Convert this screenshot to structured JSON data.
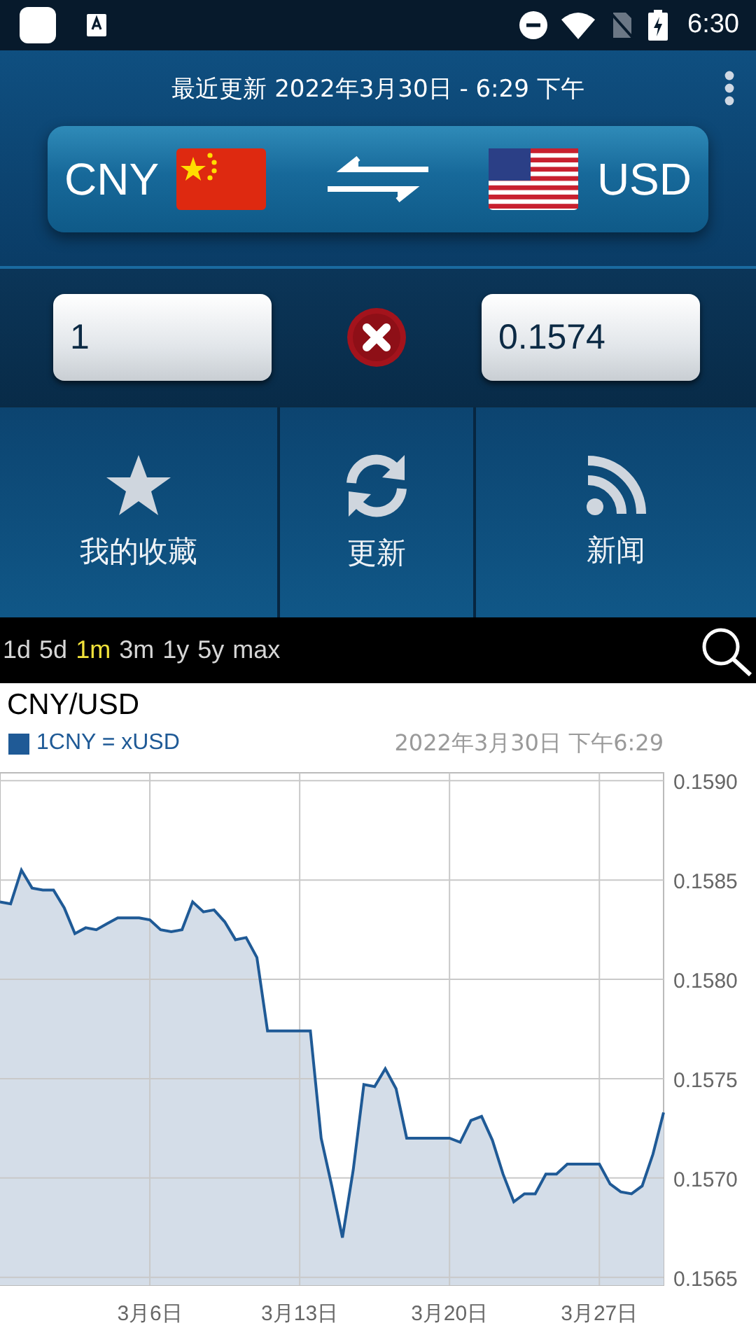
{
  "status_bar": {
    "time": "6:30"
  },
  "header": {
    "last_update": "最近更新 2022年3月30日 - 6:29 下午"
  },
  "currency_pair": {
    "from": "CNY",
    "to": "USD"
  },
  "converter": {
    "amount": "1",
    "result": "0.1574"
  },
  "actions": [
    {
      "kind": "favorites",
      "label": "我的收藏"
    },
    {
      "kind": "refresh",
      "label": "更新"
    },
    {
      "kind": "news",
      "label": "新闻"
    }
  ],
  "ranges": [
    {
      "label": "1d",
      "selected": false
    },
    {
      "label": "5d",
      "selected": false
    },
    {
      "label": "1m",
      "selected": true
    },
    {
      "label": "3m",
      "selected": false
    },
    {
      "label": "1y",
      "selected": false
    },
    {
      "label": "5y",
      "selected": false
    },
    {
      "label": "max",
      "selected": false
    }
  ],
  "chart": {
    "title": "CNY/USD",
    "timestamp": "2022年3月30日 下午6:29",
    "chart_data": {
      "type": "area",
      "grid": true,
      "ylim": [
        0.15646,
        0.15904
      ],
      "categories": [
        null,
        null,
        null,
        null,
        null,
        null,
        null,
        null,
        null,
        null,
        null,
        null,
        null,
        null,
        "3月6日",
        null,
        null,
        null,
        null,
        null,
        null,
        null,
        null,
        null,
        null,
        null,
        null,
        null,
        "3月13日",
        null,
        null,
        null,
        null,
        null,
        null,
        null,
        null,
        null,
        null,
        null,
        null,
        null,
        "3月20日",
        null,
        null,
        null,
        null,
        null,
        null,
        null,
        null,
        null,
        null,
        null,
        null,
        null,
        "3月27日",
        null,
        null,
        null,
        null,
        null,
        null
      ],
      "yticks": [
        {
          "value": 0.159,
          "label": "0.1590"
        },
        {
          "value": 0.1585,
          "label": "0.1585"
        },
        {
          "value": 0.158,
          "label": "0.1580"
        },
        {
          "value": 0.1575,
          "label": "0.1575"
        },
        {
          "value": 0.157,
          "label": "0.1570"
        },
        {
          "value": 0.1565,
          "label": "0.1565"
        }
      ],
      "series": [
        {
          "name": "1CNY = xUSD",
          "color": "#1f5a96",
          "values": [
            0.15839,
            0.15838,
            0.15855,
            0.15846,
            0.15845,
            0.15845,
            0.15836,
            0.15823,
            0.15826,
            0.15825,
            0.15828,
            0.15831,
            0.15831,
            0.15831,
            0.1583,
            0.15825,
            0.15824,
            0.15825,
            0.15839,
            0.15834,
            0.15835,
            0.15829,
            0.1582,
            0.15821,
            0.15811,
            0.15774,
            0.15774,
            0.15774,
            0.15774,
            0.15774,
            0.1572,
            0.15696,
            0.1567,
            0.15704,
            0.15747,
            0.15746,
            0.15755,
            0.15745,
            0.1572,
            0.1572,
            0.1572,
            0.1572,
            0.1572,
            0.15718,
            0.15729,
            0.15731,
            0.15719,
            0.15702,
            0.15688,
            0.15692,
            0.15692,
            0.15702,
            0.15702,
            0.15707,
            0.15707,
            0.15707,
            0.15707,
            0.15697,
            0.15693,
            0.15692,
            0.15696,
            0.15712,
            0.15733
          ]
        }
      ]
    }
  }
}
